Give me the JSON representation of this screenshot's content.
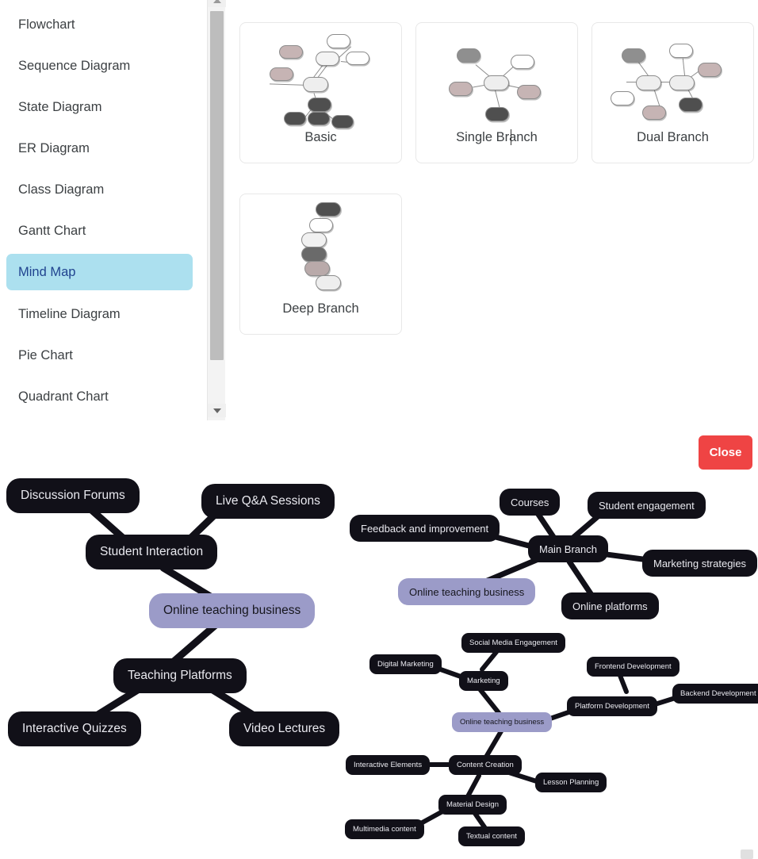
{
  "sidebar": {
    "items": [
      {
        "label": "Flowchart",
        "active": false
      },
      {
        "label": "Sequence Diagram",
        "active": false
      },
      {
        "label": "State Diagram",
        "active": false
      },
      {
        "label": "ER Diagram",
        "active": false
      },
      {
        "label": "Class Diagram",
        "active": false
      },
      {
        "label": "Gantt Chart",
        "active": false
      },
      {
        "label": "Mind Map",
        "active": true
      },
      {
        "label": "Timeline Diagram",
        "active": false
      },
      {
        "label": "Pie Chart",
        "active": false
      },
      {
        "label": "Quadrant Chart",
        "active": false
      }
    ],
    "active_highlight_color": "#ace0ef",
    "active_text_color": "#20438f"
  },
  "templates": [
    {
      "label": "Basic"
    },
    {
      "label": "Single Branch"
    },
    {
      "label": "Dual Branch"
    },
    {
      "label": "Deep Branch"
    }
  ],
  "close_button": {
    "label": "Close",
    "color": "#ef4444"
  },
  "accent_node_color": "#9b9bc8",
  "node_color": "#111018",
  "mindmaps": [
    {
      "id": "left-preview",
      "center": "Online teaching business",
      "nodes": [
        "Discussion Forums",
        "Live Q&A Sessions",
        "Student Interaction",
        "Online teaching business",
        "Teaching Platforms",
        "Interactive Quizzes",
        "Video Lectures"
      ]
    },
    {
      "id": "single-branch-preview",
      "center": "Main Branch",
      "nodes": [
        "Courses",
        "Student engagement",
        "Feedback and improvement",
        "Main Branch",
        "Marketing strategies",
        "Online teaching business",
        "Online platforms"
      ]
    },
    {
      "id": "deep-branch-preview",
      "center": "Online teaching business",
      "nodes": [
        "Social Media Engagement",
        "Digital Marketing",
        "Marketing",
        "Frontend Development",
        "Platform Development",
        "Backend Development",
        "Online teaching business",
        "Interactive Elements",
        "Content Creation",
        "Lesson Planning",
        "Material Design",
        "Multimedia content",
        "Textual content"
      ]
    }
  ]
}
